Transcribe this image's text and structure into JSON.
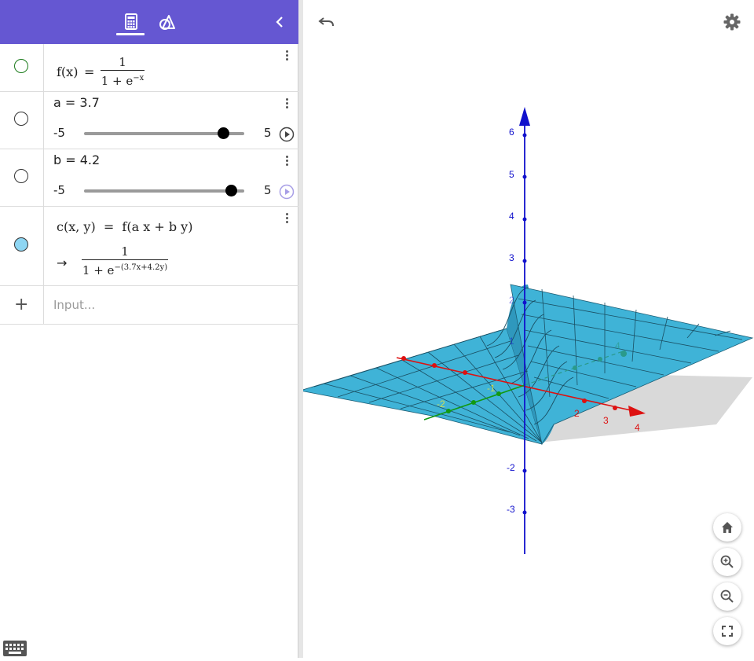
{
  "colors": {
    "toolbar": "#6557d2",
    "surface": "#3fb3d7",
    "x_axis": "#dd1111",
    "y_axis": "#119911",
    "z_axis": "#1111cc",
    "f_marble": "#1a7a1a",
    "c_marble_fill": "#8ed6f3"
  },
  "toolbar": {
    "algebra_tab_icon": "calculator-icon",
    "tools_tab_icon": "geometry-tools-icon",
    "collapse_icon": "chevron-left-icon"
  },
  "algebra": {
    "f": {
      "lhs": "f(x)",
      "eq": "=",
      "numerator": "1",
      "denominator_base": "1 + e",
      "denominator_exp": "−x"
    },
    "a": {
      "label": "a = 3.7",
      "min": "-5",
      "max": "5",
      "value": 3.7
    },
    "b": {
      "label": "b = 4.2",
      "min": "-5",
      "max": "5",
      "value": 4.2
    },
    "c": {
      "definition": "c(x, y)  =  f(a x + b y)",
      "arrow": "→",
      "numerator": "1",
      "denominator_base": "1 + e",
      "denominator_exp": "−(3.7x+4.2y)"
    },
    "input": {
      "plus": "+",
      "placeholder": "Input..."
    }
  },
  "graphics": {
    "z_ticks": [
      "6",
      "5",
      "4",
      "3",
      "2",
      "1",
      "-2",
      "-3"
    ],
    "x_ticks": [
      "2",
      "3",
      "4"
    ],
    "y_ticks": [
      "-2",
      "-1",
      "4"
    ],
    "undo_icon": "undo-icon",
    "settings_icon": "gear-icon",
    "buttons": [
      "home-icon",
      "zoom-in-icon",
      "zoom-out-icon",
      "fullscreen-icon"
    ]
  },
  "keyboard_icon": "keyboard-icon"
}
